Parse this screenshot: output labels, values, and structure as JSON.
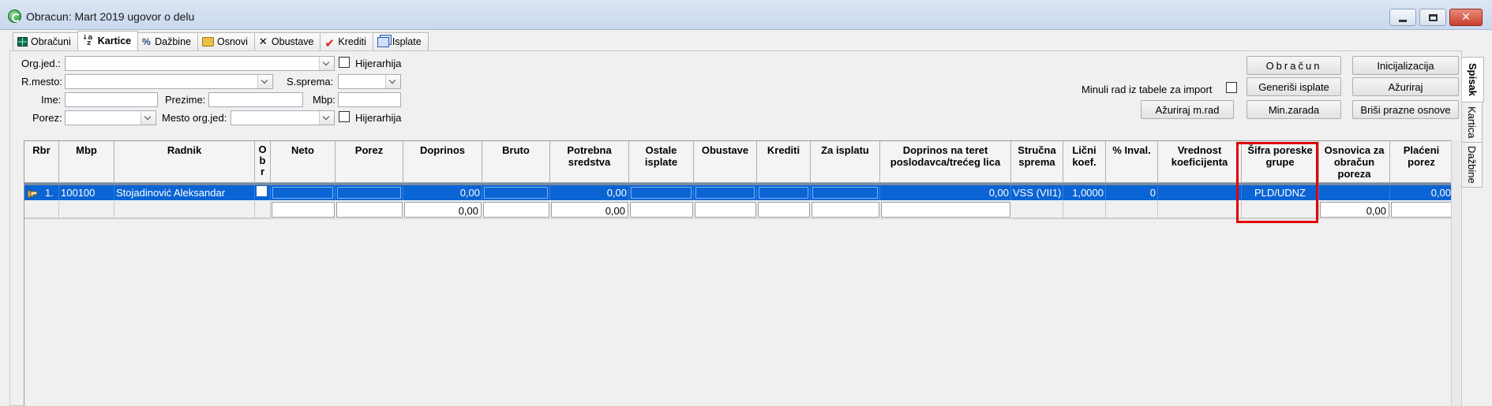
{
  "window": {
    "title": "Obracun: Mart 2019 ugovor o delu"
  },
  "tabs": [
    {
      "label": "Obračuni",
      "icon": "grid-icon"
    },
    {
      "label": "Kartice",
      "icon": "sort-az-icon",
      "active": true
    },
    {
      "label": "Dažbine",
      "icon": "percent-icon"
    },
    {
      "label": "Osnovi",
      "icon": "folder-icon"
    },
    {
      "label": "Obustave",
      "icon": "x-icon"
    },
    {
      "label": "Krediti",
      "icon": "checkmark-icon"
    },
    {
      "label": "Isplate",
      "icon": "stack-icon"
    }
  ],
  "side_tabs": [
    {
      "label": "Spisak",
      "active": true
    },
    {
      "label": "Kartica"
    },
    {
      "label": "Dažbine"
    }
  ],
  "filters": {
    "org_jed_label": "Org.jed.:",
    "hijerarhija_label": "Hijerarhija",
    "r_mesto_label": "R.mesto:",
    "s_sprema_label": "S.sprema:",
    "ime_label": "Ime:",
    "prezime_label": "Prezime:",
    "mbp_label": "Mbp:",
    "porez_label": "Porez:",
    "mesto_org_jed_label": "Mesto org.jed:",
    "hijerarhija2_label": "Hijerarhija",
    "minuli_rad_label": "Minuli rad iz tabele za import"
  },
  "buttons": {
    "obracun": "Obračun",
    "inicijalizacija": "Inicijalizacija",
    "generisi_isplate": "Generiši isplate",
    "azuriraj": "Ažuriraj",
    "azuriraj_m_rad": "Ažuriraj m.rad",
    "min_zarada": "Min.zarada",
    "brisi_prazne_osnove": "Briši prazne osnove"
  },
  "grid": {
    "headers": {
      "rbr": "Rbr",
      "mbp": "Mbp",
      "radnik": "Radnik",
      "obr1": "O",
      "obr2": "b",
      "obr3": "r",
      "neto": "Neto",
      "porez": "Porez",
      "doprinos": "Doprinos",
      "bruto": "Bruto",
      "potrebna1": "Potrebna",
      "potrebna2": "sredstva",
      "ostale1": "Ostale",
      "ostale2": "isplate",
      "obustave": "Obustave",
      "krediti": "Krediti",
      "za_isplatu": "Za isplatu",
      "dop_teret1": "Doprinos na teret",
      "dop_teret2": "poslodavca/trećeg lica",
      "strucna1": "Stručna",
      "strucna2": "sprema",
      "licni1": "Lični",
      "licni2": "koef.",
      "inval": "% Inval.",
      "vred1": "Vrednost",
      "vred2": "koeficijenta",
      "sifra1": "Šifra poreske",
      "sifra2": "grupe",
      "osnovica1": "Osnovica za",
      "osnovica2": "obračun",
      "osnovica3": "poreza",
      "placeni1": "Plaćeni",
      "placeni2": "porez"
    },
    "row": {
      "rbr": "1.",
      "mbp": "100100",
      "radnik": "Stojadinović Aleksandar",
      "doprinos": "0,00",
      "potrebna": "0,00",
      "dop_teret": "0,00",
      "strucna": "VSS (VII1)",
      "licni": "1,0000",
      "inval": "0",
      "sifra": "PLD/UDNZ",
      "placeni": "0,00"
    },
    "totals": {
      "doprinos": "0,00",
      "potrebna": "0,00",
      "osnovica": "0,00"
    }
  }
}
